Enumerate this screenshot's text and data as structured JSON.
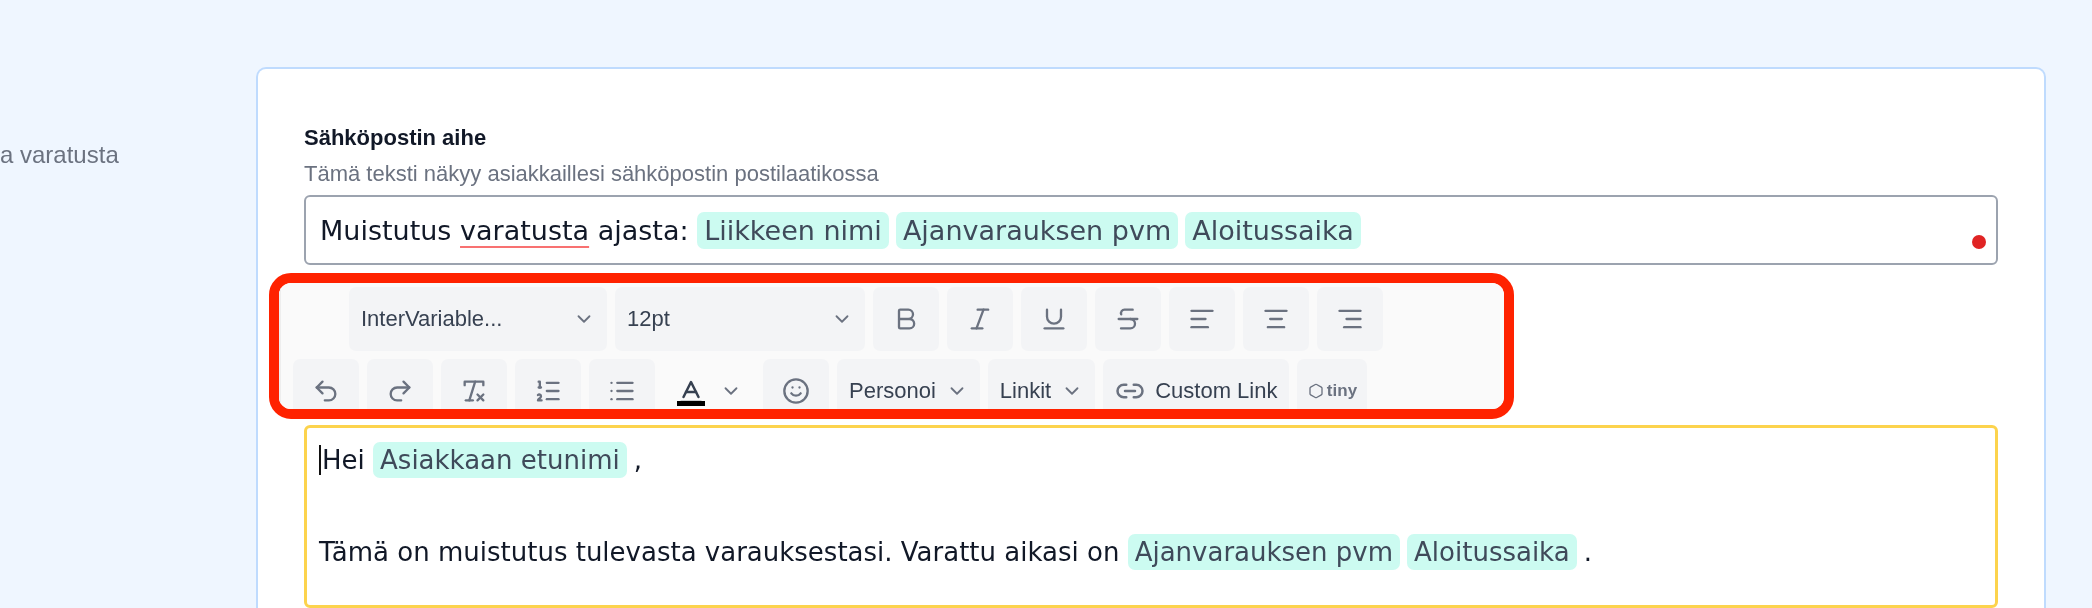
{
  "side_label": "a varatusta",
  "subject": {
    "label": "Sähköpostin aihe",
    "hint": "Tämä teksti näkyy asiakkaillesi sähköpostin postilaatikossa",
    "indicator": true,
    "segments": [
      {
        "kind": "text",
        "text": "Muistutus ",
        "misspelled": false
      },
      {
        "kind": "text",
        "text": "varatusta",
        "misspelled": true
      },
      {
        "kind": "text",
        "text": " ajasta: ",
        "misspelled": false
      },
      {
        "kind": "tag",
        "text": "Liikkeen nimi"
      },
      {
        "kind": "tag",
        "text": "Ajanvarauksen pvm"
      },
      {
        "kind": "tag",
        "text": "Aloitussaika"
      }
    ]
  },
  "toolbar": {
    "highlighted": true,
    "rows": [
      [
        {
          "kind": "select",
          "label": "InterVariable..."
        },
        {
          "kind": "select",
          "label": "12pt"
        },
        {
          "kind": "bold"
        },
        {
          "kind": "italic"
        },
        {
          "kind": "underline"
        },
        {
          "kind": "strike"
        },
        {
          "kind": "alignleft"
        },
        {
          "kind": "aligncenter"
        },
        {
          "kind": "alignright"
        }
      ],
      [
        {
          "kind": "undo"
        },
        {
          "kind": "redo"
        },
        {
          "kind": "clearformat"
        },
        {
          "kind": "orderedlist"
        },
        {
          "kind": "bulletlist"
        },
        {
          "kind": "textcolor",
          "color": "#000000"
        },
        {
          "kind": "emoji"
        },
        {
          "kind": "menu",
          "label": "Personoi"
        },
        {
          "kind": "menu",
          "label": "Linkit"
        },
        {
          "kind": "link",
          "label": "Custom Link"
        },
        {
          "kind": "brand",
          "label": "tiny"
        }
      ]
    ]
  },
  "body": {
    "focused": true,
    "paragraphs": [
      [
        {
          "kind": "text",
          "text": "Hei "
        },
        {
          "kind": "tag",
          "text": "Asiakkaan etunimi"
        },
        {
          "kind": "text",
          "text": ","
        }
      ],
      [
        {
          "kind": "text",
          "text": "Tämä on muistutus tulevasta varauksestasi. Varattu aikasi on "
        },
        {
          "kind": "tag",
          "text": "Ajanvarauksen pvm"
        },
        {
          "kind": "tag",
          "text": "Aloitussaika"
        },
        {
          "kind": "text",
          "text": "."
        }
      ]
    ]
  }
}
